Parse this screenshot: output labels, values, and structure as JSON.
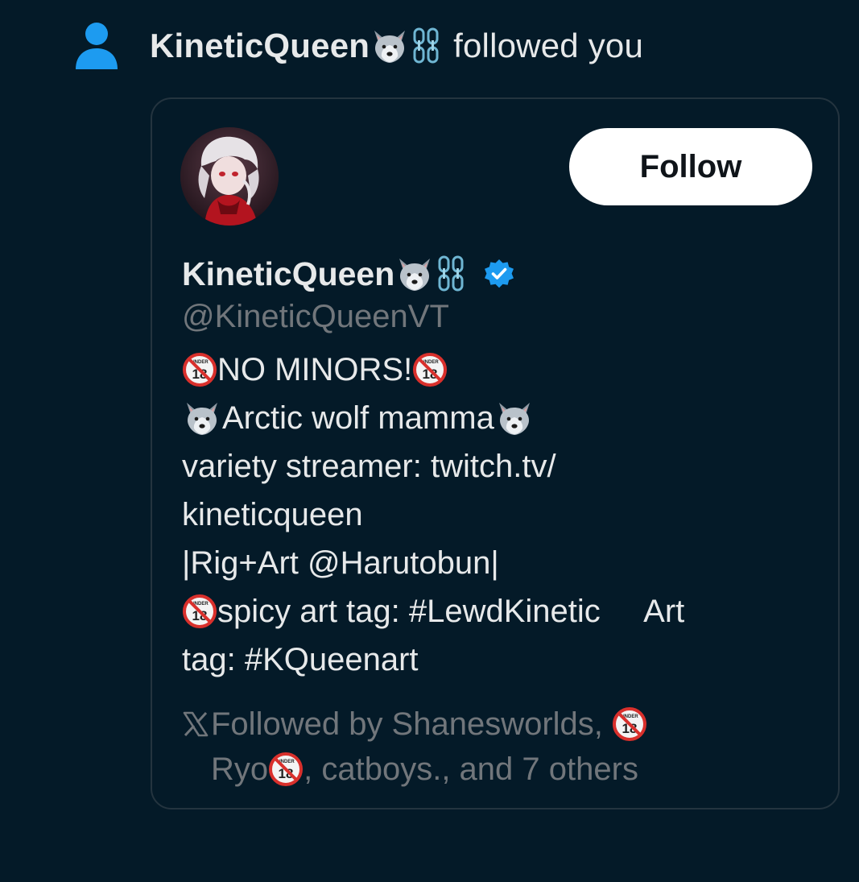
{
  "notification": {
    "user_name": "KineticQueen",
    "action_text": "followed you",
    "icon": "person-icon"
  },
  "card": {
    "follow_label": "Follow",
    "display_name": "KineticQueen",
    "handle": "@KineticQueenVT",
    "verified": true,
    "bio": {
      "line1": "NO MINORS!",
      "line2": "Arctic wolf mamma",
      "line3": "variety streamer: twitch.tv/",
      "line4": "kineticqueen",
      "line5": "|Rig+Art @Harutobun|",
      "line6": "spicy art tag: #LewdKinetic     Art",
      "line7": "tag: #KQueenart"
    },
    "followed_by": {
      "line1": "Followed by Shanesworlds, ",
      "line2_a": "Ryo",
      "line2_b": ", catboys., and 7 others"
    }
  },
  "colors": {
    "background": "#041a28",
    "accent_blue": "#1d9bf0",
    "text_primary": "#e7e9ea",
    "text_secondary": "#71767b",
    "card_border": "#24343f"
  }
}
